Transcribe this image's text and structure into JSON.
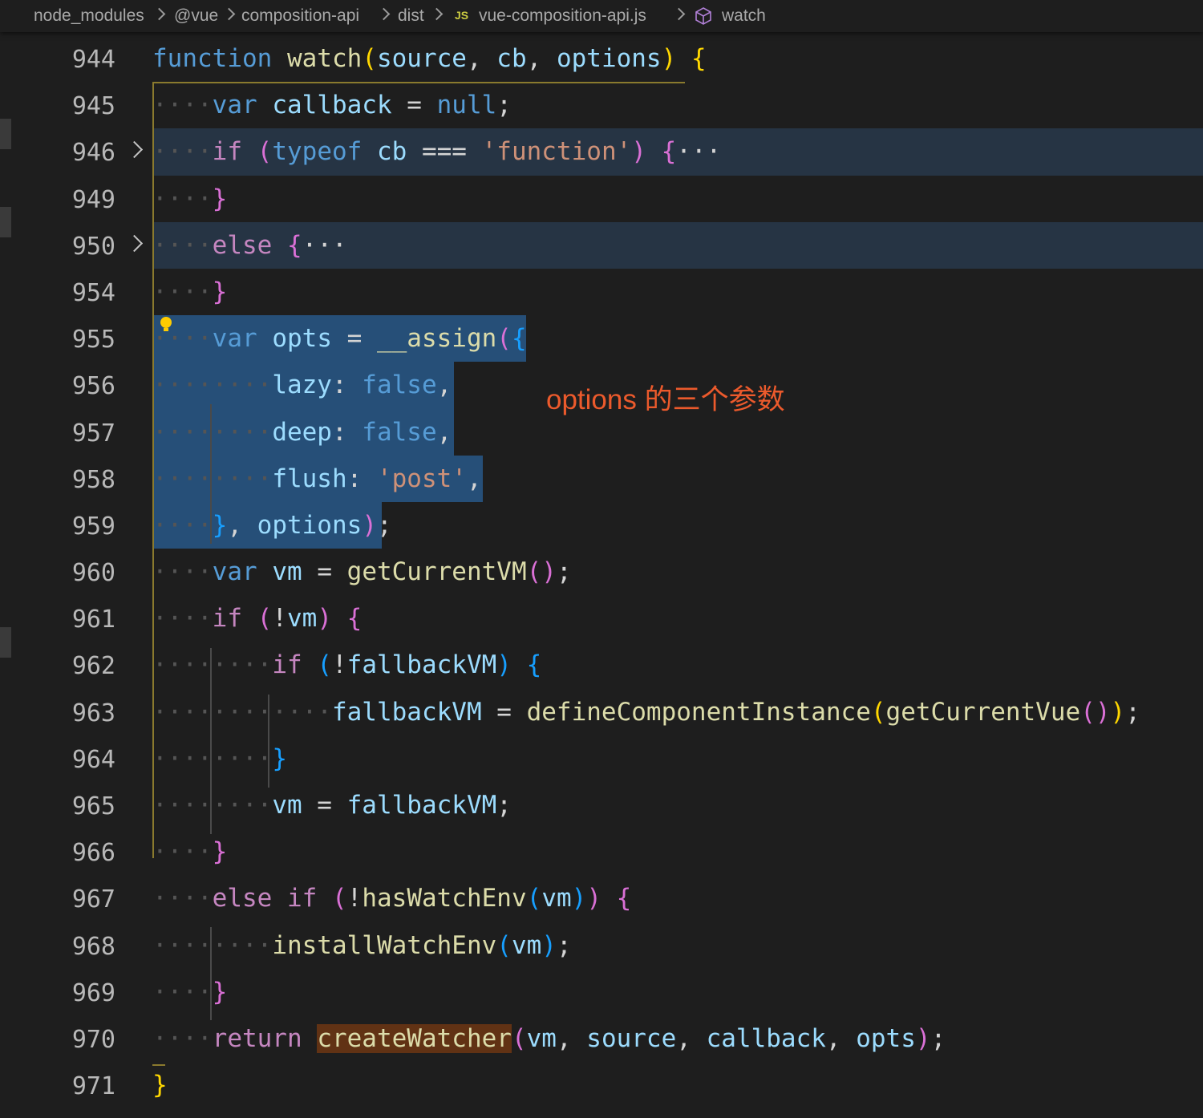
{
  "breadcrumb": {
    "items": [
      "node_modules",
      "@vue",
      "composition-api",
      "dist",
      "vue-composition-api.js",
      "watch"
    ],
    "file_badge": "JS",
    "file_icon": "js-file-icon",
    "symbol_icon": "cube-icon"
  },
  "annotation": "options 的三个参数",
  "colors": {
    "background": "#1e1e1e",
    "selection": "#264f78",
    "collapsed_highlight": "#263444",
    "annotation": "#ec5a2c",
    "word_highlight": "#613214"
  },
  "lines": [
    {
      "n": "944",
      "tokens": [
        [
          "",
          "dots"
        ],
        [
          "function",
          "st"
        ],
        [
          " ",
          "pl"
        ],
        [
          "watch",
          "fn"
        ],
        [
          "(",
          "by"
        ],
        [
          "source",
          "vr"
        ],
        [
          ", ",
          "pl"
        ],
        [
          "cb",
          "vr"
        ],
        [
          ", ",
          "pl"
        ],
        [
          "options",
          "vr"
        ],
        [
          ")",
          "by"
        ],
        [
          " ",
          "pl"
        ],
        [
          "{",
          "by"
        ]
      ]
    },
    {
      "n": "945",
      "tokens": [
        [
          "····",
          "dots"
        ],
        [
          "var",
          "st"
        ],
        [
          " ",
          "pl"
        ],
        [
          "callback",
          "vr"
        ],
        [
          " = ",
          "pl"
        ],
        [
          "null",
          "st"
        ],
        [
          ";",
          "pl"
        ]
      ]
    },
    {
      "n": "946",
      "tokens": [
        [
          "····",
          "dots"
        ],
        [
          "if",
          "kw"
        ],
        [
          " ",
          "pl"
        ],
        [
          "(",
          "bp"
        ],
        [
          "typeof",
          "st"
        ],
        [
          " ",
          "pl"
        ],
        [
          "cb",
          "vr"
        ],
        [
          " === ",
          "pl"
        ],
        [
          "'function'",
          "str"
        ],
        [
          ")",
          "bp"
        ],
        [
          " ",
          "pl"
        ],
        [
          "{",
          "bp"
        ],
        [
          "···",
          "pl"
        ]
      ]
    },
    {
      "n": "949",
      "tokens": [
        [
          "····",
          "dots"
        ],
        [
          "}",
          "bp"
        ]
      ]
    },
    {
      "n": "950",
      "tokens": [
        [
          "····",
          "dots"
        ],
        [
          "else",
          "kw"
        ],
        [
          " ",
          "pl"
        ],
        [
          "{",
          "bp"
        ],
        [
          "···",
          "pl"
        ]
      ]
    },
    {
      "n": "954",
      "tokens": [
        [
          "····",
          "dots"
        ],
        [
          "}",
          "bp"
        ]
      ]
    },
    {
      "n": "955",
      "tokens": [
        [
          "····",
          "dots"
        ],
        [
          "var",
          "st"
        ],
        [
          " ",
          "pl"
        ],
        [
          "opts",
          "vr"
        ],
        [
          " = ",
          "pl"
        ],
        [
          "__assign",
          "fn"
        ],
        [
          "(",
          "bp"
        ],
        [
          "{",
          "bb"
        ]
      ]
    },
    {
      "n": "956",
      "tokens": [
        [
          "········",
          "dots"
        ],
        [
          "lazy",
          "vr"
        ],
        [
          ": ",
          "pl"
        ],
        [
          "false",
          "st"
        ],
        [
          ",",
          "pl"
        ]
      ]
    },
    {
      "n": "957",
      "tokens": [
        [
          "········",
          "dots"
        ],
        [
          "deep",
          "vr"
        ],
        [
          ": ",
          "pl"
        ],
        [
          "false",
          "st"
        ],
        [
          ",",
          "pl"
        ]
      ]
    },
    {
      "n": "958",
      "tokens": [
        [
          "········",
          "dots"
        ],
        [
          "flush",
          "vr"
        ],
        [
          ": ",
          "pl"
        ],
        [
          "'post'",
          "str"
        ],
        [
          ",",
          "pl"
        ]
      ]
    },
    {
      "n": "959",
      "tokens": [
        [
          "····",
          "dots"
        ],
        [
          "}",
          "bb"
        ],
        [
          ", ",
          "pl"
        ],
        [
          "options",
          "vr"
        ],
        [
          ")",
          "bp"
        ],
        [
          ";",
          "pl"
        ]
      ]
    },
    {
      "n": "960",
      "tokens": [
        [
          "····",
          "dots"
        ],
        [
          "var",
          "st"
        ],
        [
          " ",
          "pl"
        ],
        [
          "vm",
          "vr"
        ],
        [
          " = ",
          "pl"
        ],
        [
          "getCurrentVM",
          "fn"
        ],
        [
          "()",
          "bp"
        ],
        [
          ";",
          "pl"
        ]
      ]
    },
    {
      "n": "961",
      "tokens": [
        [
          "····",
          "dots"
        ],
        [
          "if",
          "kw"
        ],
        [
          " ",
          "pl"
        ],
        [
          "(",
          "bp"
        ],
        [
          "!",
          "pl"
        ],
        [
          "vm",
          "vr"
        ],
        [
          ")",
          "bp"
        ],
        [
          " ",
          "pl"
        ],
        [
          "{",
          "bp"
        ]
      ]
    },
    {
      "n": "962",
      "tokens": [
        [
          "········",
          "dots"
        ],
        [
          "if",
          "kw"
        ],
        [
          " ",
          "pl"
        ],
        [
          "(",
          "bb"
        ],
        [
          "!",
          "pl"
        ],
        [
          "fallbackVM",
          "vr"
        ],
        [
          ")",
          "bb"
        ],
        [
          " ",
          "pl"
        ],
        [
          "{",
          "bb"
        ]
      ]
    },
    {
      "n": "963",
      "tokens": [
        [
          "············",
          "dots"
        ],
        [
          "fallbackVM",
          "vr"
        ],
        [
          " = ",
          "pl"
        ],
        [
          "defineComponentInstance",
          "fn"
        ],
        [
          "(",
          "by"
        ],
        [
          "getCurrentVue",
          "fn"
        ],
        [
          "()",
          "bp"
        ],
        [
          ")",
          "by"
        ],
        [
          ";",
          "pl"
        ]
      ]
    },
    {
      "n": "964",
      "tokens": [
        [
          "········",
          "dots"
        ],
        [
          "}",
          "bb"
        ]
      ]
    },
    {
      "n": "965",
      "tokens": [
        [
          "········",
          "dots"
        ],
        [
          "vm",
          "vr"
        ],
        [
          " = ",
          "pl"
        ],
        [
          "fallbackVM",
          "vr"
        ],
        [
          ";",
          "pl"
        ]
      ]
    },
    {
      "n": "966",
      "tokens": [
        [
          "····",
          "dots"
        ],
        [
          "}",
          "bp"
        ]
      ]
    },
    {
      "n": "967",
      "tokens": [
        [
          "····",
          "dots"
        ],
        [
          "else",
          "kw"
        ],
        [
          " ",
          "pl"
        ],
        [
          "if",
          "kw"
        ],
        [
          " ",
          "pl"
        ],
        [
          "(",
          "bp"
        ],
        [
          "!",
          "pl"
        ],
        [
          "hasWatchEnv",
          "fn"
        ],
        [
          "(",
          "bb"
        ],
        [
          "vm",
          "vr"
        ],
        [
          ")",
          "bb"
        ],
        [
          ")",
          "bp"
        ],
        [
          " ",
          "pl"
        ],
        [
          "{",
          "bp"
        ]
      ]
    },
    {
      "n": "968",
      "tokens": [
        [
          "········",
          "dots"
        ],
        [
          "installWatchEnv",
          "fn"
        ],
        [
          "(",
          "bb"
        ],
        [
          "vm",
          "vr"
        ],
        [
          ")",
          "bb"
        ],
        [
          ";",
          "pl"
        ]
      ]
    },
    {
      "n": "969",
      "tokens": [
        [
          "····",
          "dots"
        ],
        [
          "}",
          "bp"
        ]
      ]
    },
    {
      "n": "970",
      "tokens": [
        [
          "····",
          "dots"
        ],
        [
          "return",
          "kw"
        ],
        [
          " ",
          "pl"
        ],
        [
          "createWatcher",
          "fn wordhl"
        ],
        [
          "(",
          "bp"
        ],
        [
          "vm",
          "vr"
        ],
        [
          ", ",
          "pl"
        ],
        [
          "source",
          "vr"
        ],
        [
          ", ",
          "pl"
        ],
        [
          "callback",
          "vr"
        ],
        [
          ", ",
          "pl"
        ],
        [
          "opts",
          "vr"
        ],
        [
          ")",
          "bp"
        ],
        [
          ";",
          "pl"
        ]
      ]
    },
    {
      "n": "971",
      "tokens": [
        [
          "",
          "dots"
        ],
        [
          "}",
          "by"
        ]
      ]
    }
  ]
}
